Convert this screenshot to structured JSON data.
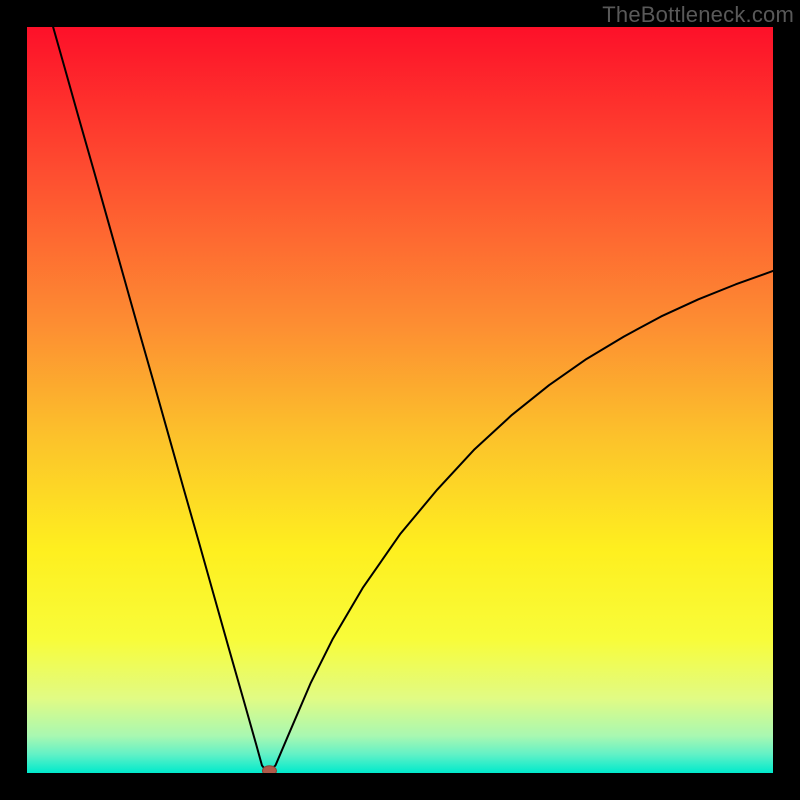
{
  "watermark": {
    "text": "TheBottleneck.com"
  },
  "chart_data": {
    "type": "line",
    "title": "",
    "xlabel": "",
    "ylabel": "",
    "xlim": [
      0,
      100
    ],
    "ylim": [
      0,
      100
    ],
    "grid": false,
    "legend": false,
    "background_gradient": {
      "direction": "vertical",
      "stops": [
        {
          "pos": 0.0,
          "color": "#fd1029"
        },
        {
          "pos": 0.2,
          "color": "#fe4f30"
        },
        {
          "pos": 0.4,
          "color": "#fd8e32"
        },
        {
          "pos": 0.55,
          "color": "#fcc22b"
        },
        {
          "pos": 0.7,
          "color": "#feef1f"
        },
        {
          "pos": 0.82,
          "color": "#f8fc39"
        },
        {
          "pos": 0.9,
          "color": "#e1fb84"
        },
        {
          "pos": 0.95,
          "color": "#a9f8b1"
        },
        {
          "pos": 0.975,
          "color": "#62f1c6"
        },
        {
          "pos": 1.0,
          "color": "#00eacc"
        }
      ]
    },
    "series": [
      {
        "name": "bottleneck-curve",
        "x": [
          3.5,
          5,
          7,
          9,
          11,
          13,
          15,
          17,
          19,
          21,
          23,
          25,
          27,
          29,
          30.7,
          31.5,
          32,
          32.6,
          33.3,
          35,
          38,
          41,
          45,
          50,
          55,
          60,
          65,
          70,
          75,
          80,
          85,
          90,
          95,
          100
        ],
        "y": [
          100,
          94.7,
          87.6,
          80.6,
          73.5,
          66.4,
          59.3,
          52.3,
          45.2,
          38.1,
          31.1,
          24.0,
          16.9,
          9.9,
          3.9,
          1.0,
          0.4,
          0.4,
          1.0,
          5.0,
          12.0,
          18.0,
          24.8,
          32.0,
          38.0,
          43.4,
          48.0,
          52.0,
          55.5,
          58.5,
          61.2,
          63.5,
          65.5,
          67.3
        ]
      }
    ],
    "marker": {
      "x": 32.5,
      "y": 0.3,
      "color": "#b05a4a"
    },
    "frame": {
      "border_color": "#000000",
      "border_px": 27
    }
  }
}
